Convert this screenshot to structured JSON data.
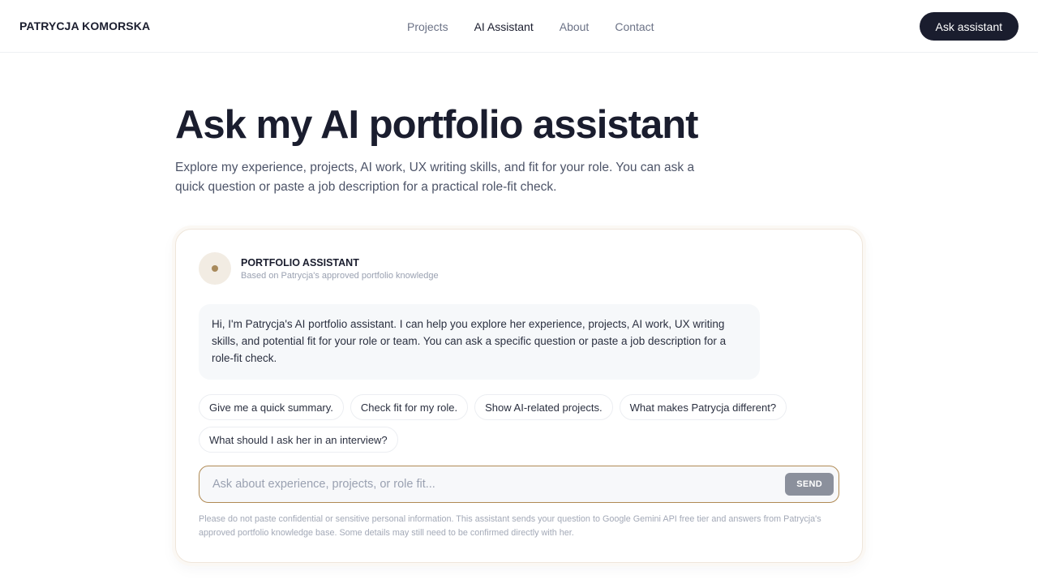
{
  "header": {
    "brand": "PATRYCJA KOMORSKA",
    "nav": [
      {
        "label": "Projects",
        "active": false
      },
      {
        "label": "AI Assistant",
        "active": true
      },
      {
        "label": "About",
        "active": false
      },
      {
        "label": "Contact",
        "active": false
      }
    ],
    "cta_label": "Ask assistant"
  },
  "hero": {
    "title": "Ask my AI portfolio assistant",
    "subtitle": "Explore my experience, projects, AI work, UX writing skills, and fit for your role. You can ask a quick question or paste a job description for a practical role-fit check."
  },
  "assistant": {
    "title": "PORTFOLIO ASSISTANT",
    "subtitle": "Based on Patrycja's approved portfolio knowledge",
    "greeting": "Hi, I'm Patrycja's AI portfolio assistant. I can help you explore her experience, projects, AI work, UX writing skills, and potential fit for your role or team. You can ask a specific question or paste a job description for a role-fit check.",
    "suggestions": [
      "Give me a quick summary.",
      "Check fit for my role.",
      "Show AI-related projects.",
      "What makes Patrycja different?",
      "What should I ask her in an interview?"
    ],
    "input": {
      "value": "",
      "placeholder": "Ask about experience, projects, or role fit..."
    },
    "send_label": "SEND",
    "disclaimer": "Please do not paste confidential or sensitive personal information. This assistant sends your question to Google Gemini API free tier and answers from Patrycja's approved portfolio knowledge base. Some details may still need to be confirmed directly with her."
  },
  "colors": {
    "primary": "#1a1d2e",
    "accent": "#b08a54",
    "avatar_bg": "#f2ece3",
    "send_button": "#8b909c"
  },
  "icons": {
    "avatar": "assistant-dot-icon"
  }
}
